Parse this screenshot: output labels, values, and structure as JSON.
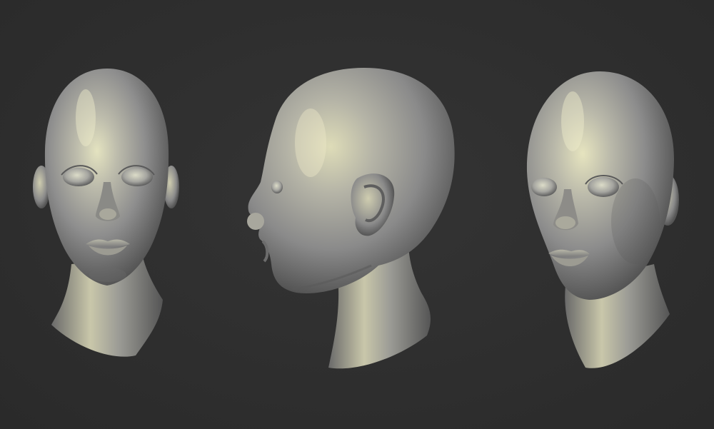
{
  "scene": {
    "background": "#2f2f2f",
    "material": {
      "base": "#9a9a9a",
      "shadow": "#5a5a5a",
      "highlight": "#e6e6c2",
      "sheen": "#d9d89a"
    },
    "views": [
      {
        "name": "front-view"
      },
      {
        "name": "side-profile-view"
      },
      {
        "name": "three-quarter-view"
      }
    ]
  }
}
